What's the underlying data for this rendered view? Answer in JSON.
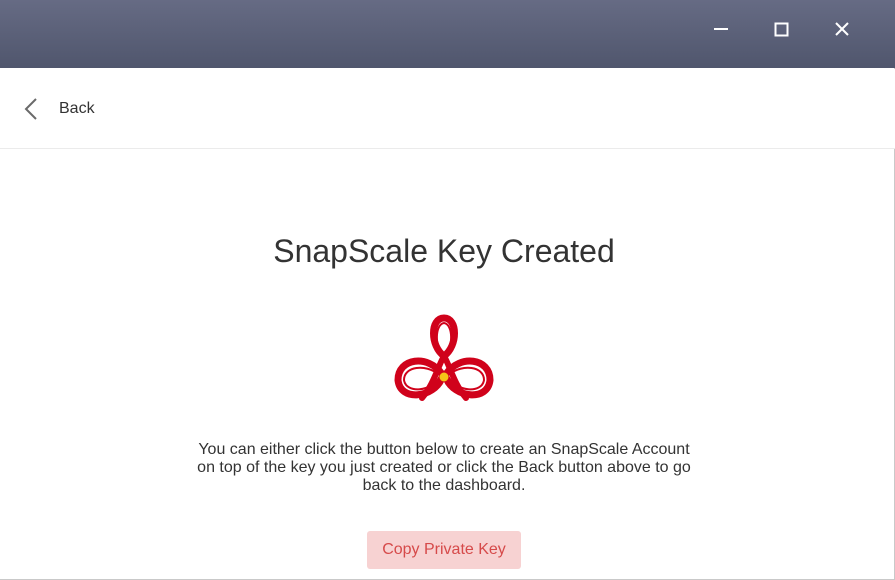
{
  "window": {
    "minimize_icon": "minimize-icon",
    "maximize_icon": "maximize-icon",
    "close_icon": "close-icon",
    "titlebar_color": "#565b72"
  },
  "nav": {
    "back_label": "Back",
    "back_icon": "chevron-left-icon"
  },
  "main": {
    "title": "SnapScale Key Created",
    "logo_icon": "snapscale-logo",
    "description": "You can either click the button below to create an SnapScale Account on top of the key you just created or click the Back button above to go back to the dashboard.",
    "copy_button_label": "Copy Private Key"
  },
  "colors": {
    "brand_red": "#d0021b",
    "button_bg": "#f7d2d2",
    "button_text": "#d64a4a",
    "accent_yellow": "#f5c518"
  }
}
